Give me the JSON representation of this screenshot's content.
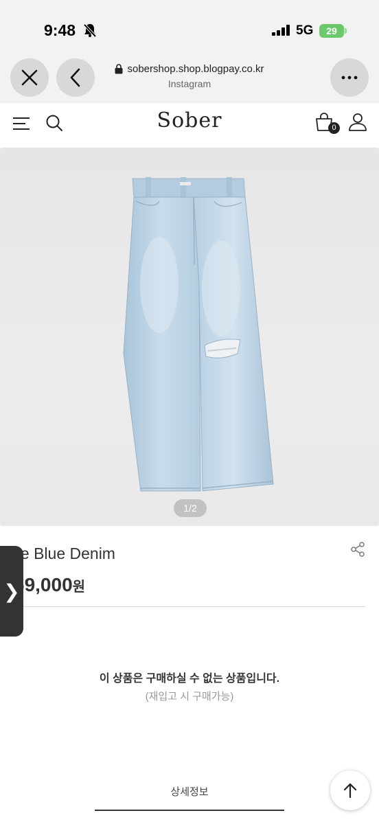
{
  "status": {
    "time": "9:48",
    "network": "5G",
    "battery": "29"
  },
  "browser": {
    "url": "sobershop.shop.blogpay.co.kr",
    "subtitle": "Instagram"
  },
  "site": {
    "logo": "Sober",
    "cart_count": "0"
  },
  "product": {
    "page_indicator": "1/2",
    "name": "Ice Blue Denim",
    "price": "69,000",
    "currency": "원",
    "soldout_message": "이 상품은 구매하실 수 없는 상품입니다.",
    "restock_message": "(재입고 시 구매가능)",
    "detail_tab": "상세정보"
  },
  "side_tab": {
    "glyph": "❯"
  },
  "colors": {
    "battery": "#6bc96b",
    "text_dark": "#333333",
    "denim": "#b9d2e4"
  }
}
